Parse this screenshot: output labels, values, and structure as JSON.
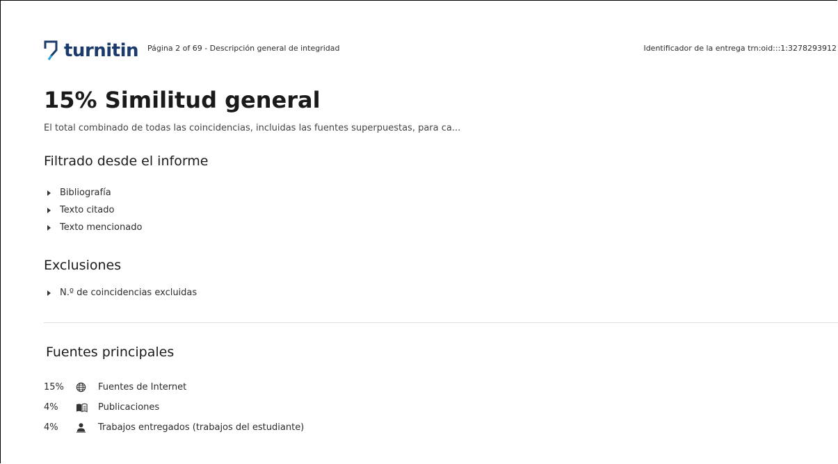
{
  "header": {
    "logo_text": "turnitin",
    "page_info": "Página 2 of 69 - Descripción general de integridad",
    "submission_id": "Identificador de la entrega trn:oid:::1:3278293912"
  },
  "main": {
    "title": "15% Similitud general",
    "subtitle": "El total combinado de todas las coincidencias, incluidas las fuentes superpuestas, para ca..."
  },
  "filtered": {
    "title": "Filtrado desde el informe",
    "items": [
      "Bibliografía",
      "Texto citado",
      "Texto mencionado"
    ]
  },
  "exclusions": {
    "title": "Exclusiones",
    "items": [
      "N.º de coincidencias excluidas"
    ]
  },
  "sources": {
    "title": "Fuentes principales",
    "items": [
      {
        "percent": "15%",
        "icon": "globe-icon",
        "label": "Fuentes de Internet"
      },
      {
        "percent": "4%",
        "icon": "book-icon",
        "label": "Publicaciones"
      },
      {
        "percent": "4%",
        "icon": "person-icon",
        "label": "Trabajos entregados (trabajos del estudiante)"
      }
    ]
  },
  "colors": {
    "brand": "#1a3a6b",
    "accent": "#2aa0d8"
  }
}
